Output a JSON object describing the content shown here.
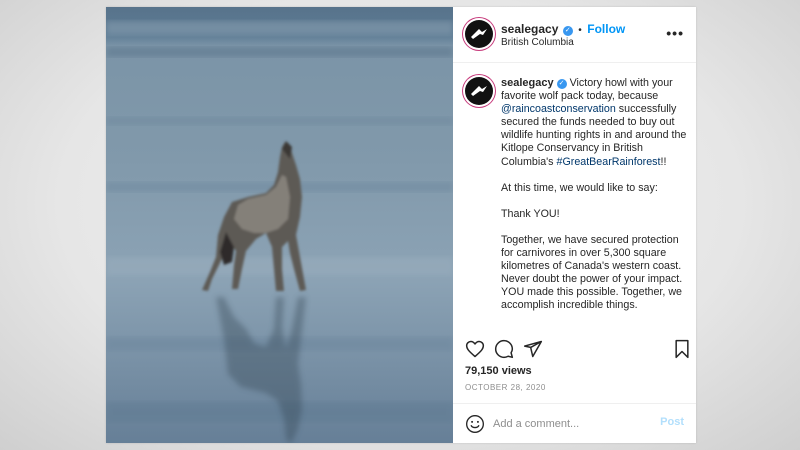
{
  "post": {
    "username": "sealegacy",
    "verified": true,
    "follow_dot": "•",
    "follow_label": "Follow",
    "location": "British Columbia",
    "more_glyph": "•••"
  },
  "photo": {
    "subject": "howling wolf on wet beach",
    "palette": [
      "#5d7890",
      "#7a94a8",
      "#8aa1b4",
      "#65809a"
    ]
  },
  "caption": {
    "username": "sealegacy",
    "p1_a": "Victory howl with your favorite wolf pack today, because ",
    "mention": "@raincoastconservation",
    "p1_b": " successfully secured the funds needed to buy out wildlife hunting rights in and around the Kitlope Conservancy in British Columbia's ",
    "hashtag": "#GreatBearRainforest",
    "p1_c": "!!",
    "p2": "At this time, we would like to say:",
    "p3": "Thank YOU!",
    "p4": "Together, we have secured protection for carnivores in over 5,300 square kilometres of Canada's western coast. Never doubt the power of your impact. YOU made this possible. Together, we accomplish incredible things."
  },
  "actions": {
    "icons": [
      "heart-icon",
      "comment-icon",
      "share-icon",
      "bookmark-icon"
    ]
  },
  "stats": {
    "views": "79,150 views",
    "date": "OCTOBER 28, 2020"
  },
  "comment": {
    "placeholder": "Add a comment...",
    "post_label": "Post"
  },
  "colors": {
    "accent": "#0095f6",
    "verified": "#3897f0",
    "post_disabled": "#b2dffc",
    "link": "#00376b"
  }
}
